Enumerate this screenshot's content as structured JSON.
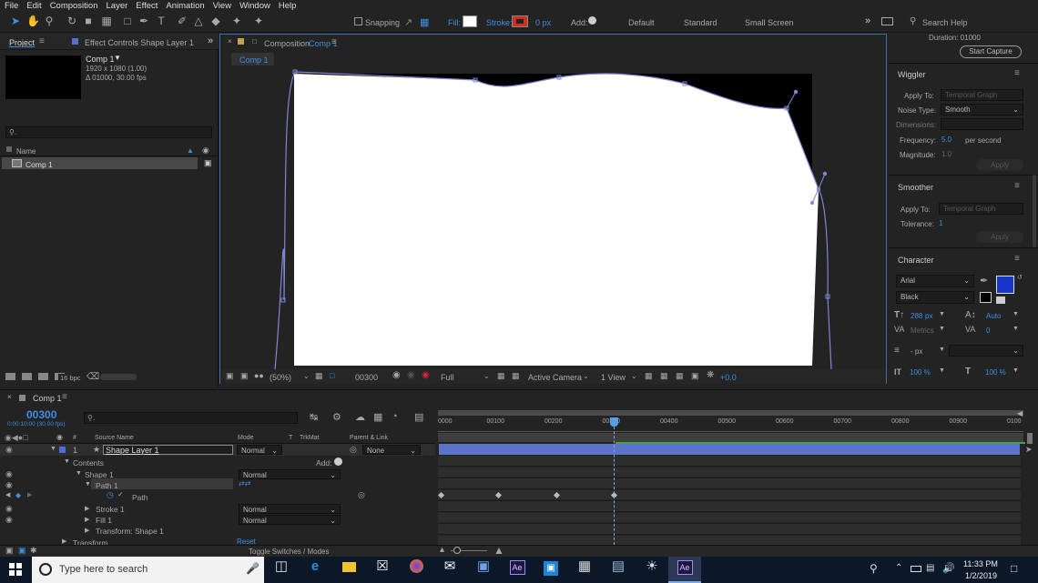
{
  "menu": [
    "File",
    "Edit",
    "Composition",
    "Layer",
    "Effect",
    "Animation",
    "View",
    "Window",
    "Help"
  ],
  "toolbar": {
    "snapping": "Snapping",
    "fill": "Fill:",
    "stroke": "Stroke:",
    "stroke_px": "0 px",
    "add": "Add:",
    "workspaces": [
      "Default",
      "Standard",
      "Small Screen"
    ],
    "search_help": "Search Help"
  },
  "project": {
    "tab": "Project",
    "effect_controls": "Effect Controls Shape Layer 1",
    "comp_name": "Comp 1",
    "comp_info": [
      "1920 x 1080 (1.00)",
      "Δ 01000, 30.00 fps"
    ],
    "col_name": "Name",
    "item": "Comp 1",
    "bpc": "16 bpc"
  },
  "composition": {
    "tab_label": "Composition",
    "tab_comp": "Comp 1",
    "crumb": "Comp 1",
    "zoom": "(50%)",
    "timecode": "00300",
    "resolution": "Full",
    "camera": "Active Camera",
    "view": "1 View",
    "exposure": "+0.0"
  },
  "right": {
    "duration": "Duration:  01000",
    "start_capture": "Start Capture",
    "wiggler": {
      "title": "Wiggler",
      "apply_to_label": "Apply To:",
      "apply_to": "Temporal Graph",
      "noise_label": "Noise Type:",
      "noise": "Smooth",
      "dimensions_label": "Dimensions:",
      "frequency_label": "Frequency:",
      "frequency": "5.0",
      "per_second": "per second",
      "magnitude_label": "Magnitude:",
      "magnitude": "1.0",
      "apply": "Apply"
    },
    "smoother": {
      "title": "Smoother",
      "apply_to_label": "Apply To:",
      "apply_to": "Temporal Graph",
      "tolerance_label": "Tolerance:",
      "tolerance": "1",
      "apply": "Apply"
    },
    "character": {
      "title": "Character",
      "font": "Arial",
      "style": "Black",
      "size": "288",
      "size_unit": "px",
      "leading": "Auto",
      "kerning": "Metrics",
      "tracking": "0",
      "stroke_width": "- px",
      "vscale": "100 %",
      "hscale": "100 %",
      "fill_color": "#1a36c8"
    }
  },
  "timeline": {
    "tab": "Comp 1",
    "timecode": "00300",
    "sub_tc": "0:00:10:00 (30.00 fps)",
    "cols": {
      "source": "Source Name",
      "mode": "Mode",
      "t": "T",
      "trkmat": "TrkMat",
      "parent": "Parent & Link"
    },
    "layer_num": "1",
    "layer_name": "Shape Layer 1",
    "layer_mode": "Normal",
    "parent": "None",
    "contents": "Contents",
    "add": "Add:",
    "shape1": "Shape 1",
    "shape1_mode": "Normal",
    "path1": "Path 1",
    "path": "Path",
    "stroke1": "Stroke 1",
    "stroke1_mode": "Normal",
    "fill1": "Fill 1",
    "fill1_mode": "Normal",
    "transform_shape": "Transform: Shape 1",
    "transform": "Transform",
    "reset": "Reset",
    "toggle": "Toggle Switches / Modes",
    "ruler": [
      "0000",
      "00100",
      "00200",
      "00300",
      "00400",
      "00500",
      "00600",
      "00700",
      "00800",
      "00900",
      "0100"
    ]
  },
  "taskbar": {
    "search": "Type here to search",
    "time": "11:33 PM",
    "date": "1/2/2019"
  }
}
